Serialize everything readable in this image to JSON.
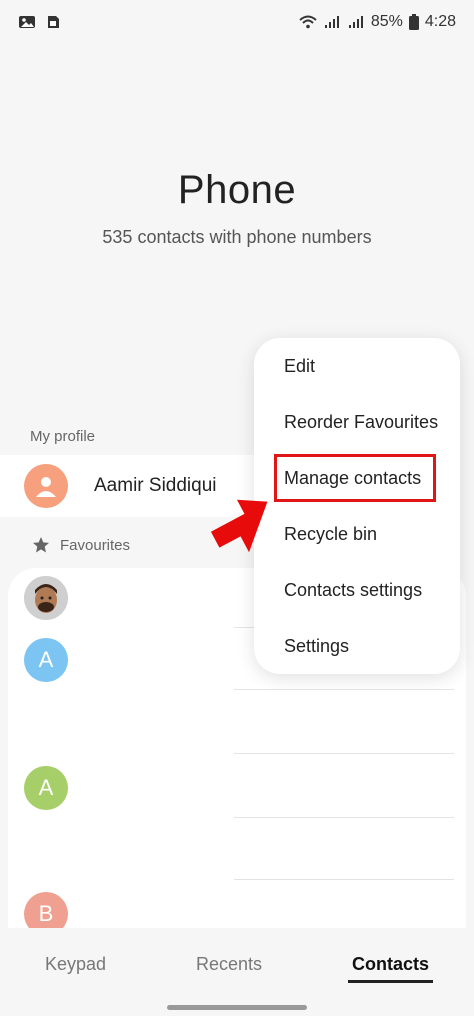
{
  "status_bar": {
    "battery": "85%",
    "time": "4:28",
    "icons": [
      "gallery-icon",
      "sim-icon",
      "wifi-icon",
      "signal-icon",
      "signal-icon",
      "battery-icon"
    ]
  },
  "header": {
    "title": "Phone",
    "subtitle": "535 contacts with phone numbers"
  },
  "my_profile": {
    "label": "My profile",
    "name": "Aamir Siddiqui",
    "avatar_color": "#f6a07e"
  },
  "favourites": {
    "label": "Favourites",
    "contacts": [
      {
        "initial": "",
        "avatar": "memoji"
      },
      {
        "initial": "A",
        "avatar_color": "#7cc4f2"
      },
      {
        "initial": "",
        "avatar": "blank"
      },
      {
        "initial": "A",
        "avatar_color": "#a6cf6a"
      },
      {
        "initial": "",
        "avatar": "blank"
      },
      {
        "initial": "B",
        "avatar_color": "#f0a090"
      }
    ]
  },
  "menu": {
    "items": [
      "Edit",
      "Reorder Favourites",
      "Manage contacts",
      "Recycle bin",
      "Contacts settings",
      "Settings"
    ],
    "highlighted": "Manage contacts",
    "highlight_color": "#e01515"
  },
  "bottom_nav": {
    "tabs": [
      "Keypad",
      "Recents",
      "Contacts"
    ],
    "active": "Contacts"
  }
}
